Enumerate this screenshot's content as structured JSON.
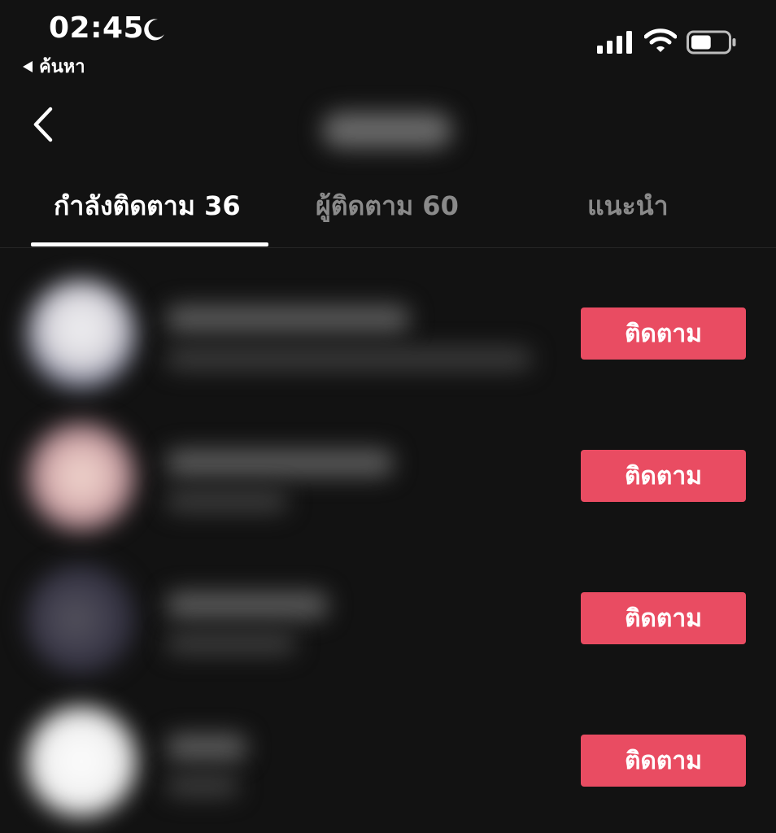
{
  "status_bar": {
    "time": "02:45",
    "back_app_label": "ค้นหา",
    "icons": [
      "moon-icon",
      "signal-icon",
      "wifi-icon",
      "battery-icon"
    ],
    "battery_level": 0.55
  },
  "nav": {
    "back_icon": "chevron-left-icon"
  },
  "tabs": [
    {
      "label": "กำลังติดตาม 36",
      "active": true
    },
    {
      "label": "ผู้ติดตาม 60",
      "active": false
    },
    {
      "label": "แนะนำ",
      "active": false
    }
  ],
  "users": [
    {
      "follow_label": "ติดตาม"
    },
    {
      "follow_label": "ติดตาม"
    },
    {
      "follow_label": "ติดตาม"
    },
    {
      "follow_label": "ติดตาม"
    }
  ],
  "colors": {
    "background": "#121212",
    "accent": "#e94c62",
    "tab_inactive": "#8a8a8a"
  }
}
